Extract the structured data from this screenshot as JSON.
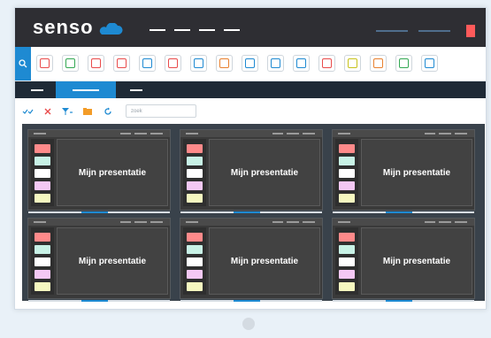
{
  "header": {
    "logo_text": "senso",
    "colors": {
      "bg": "#2e2e33",
      "accent_red": "#ff5a5a",
      "brand_blue": "#1e8ad2"
    }
  },
  "toolbar": {
    "icons": [
      {
        "name": "stop-icon",
        "color": "#e94b4b"
      },
      {
        "name": "chart-icon",
        "color": "#33a853"
      },
      {
        "name": "settings-icon",
        "color": "#e94b4b"
      },
      {
        "name": "message-icon",
        "color": "#e94b4b"
      },
      {
        "name": "image-icon",
        "color": "#1e8ad2"
      },
      {
        "name": "frame-icon",
        "color": "#e94b4b"
      },
      {
        "name": "record-icon",
        "color": "#1e8ad2"
      },
      {
        "name": "brush-icon",
        "color": "#e8812f"
      },
      {
        "name": "document-icon",
        "color": "#1e8ad2"
      },
      {
        "name": "graph-icon",
        "color": "#1e8ad2"
      },
      {
        "name": "export-icon",
        "color": "#1e8ad2"
      },
      {
        "name": "arrow-icon",
        "color": "#e94b4b"
      },
      {
        "name": "coin-icon",
        "color": "#c7c21a"
      },
      {
        "name": "user-icon",
        "color": "#e8812f"
      },
      {
        "name": "refresh-icon",
        "color": "#33a853"
      },
      {
        "name": "expand-icon",
        "color": "#1e8ad2"
      }
    ]
  },
  "filter": {
    "search_placeholder": "zoek"
  },
  "presentations": [
    {
      "title": "Mijn presentatie"
    },
    {
      "title": "Mijn presentatie"
    },
    {
      "title": "Mijn presentatie"
    },
    {
      "title": "Mijn presentatie"
    },
    {
      "title": "Mijn presentatie"
    },
    {
      "title": "Mijn presentatie"
    }
  ],
  "note_colors": [
    "#ff8a8a",
    "#c8f2e6",
    "#ffffff",
    "#f4c8f4",
    "#f6f8c0"
  ]
}
